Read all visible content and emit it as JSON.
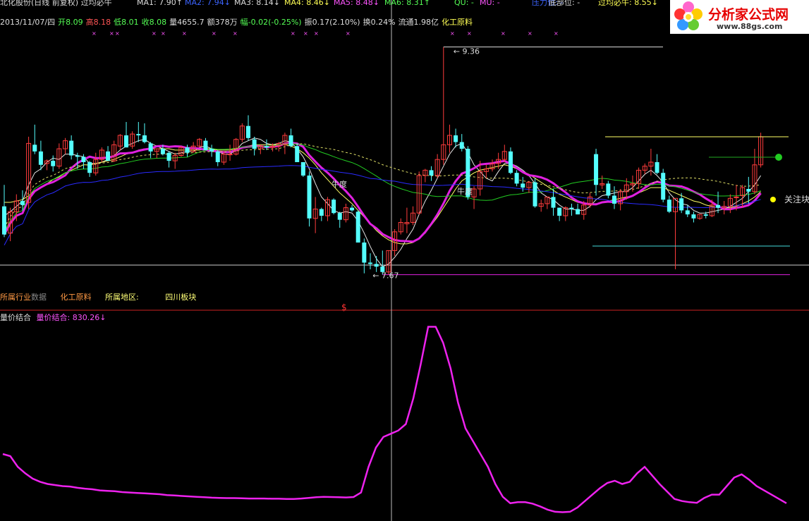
{
  "header_top": [
    {
      "text": "北化股份(日线 前复权) 过均必牛",
      "color": "#dddddd"
    },
    {
      "text": "MA1: 7.90↑",
      "color": "#dddddd"
    },
    {
      "text": "MA2: 7.94↓",
      "color": "#3c64ff"
    },
    {
      "text": "MA3: 8.14↓",
      "color": "#dddddd"
    },
    {
      "text": "MA4: 8.46↓",
      "color": "#ffff55"
    },
    {
      "text": "MA5: 8.48↓",
      "color": "#ff55ff"
    },
    {
      "text": "MA6: 8.31↑",
      "color": "#55ff55"
    },
    {
      "text": "QU: -",
      "color": "#55ff55"
    },
    {
      "text": "MU: -",
      "color": "#ff55ff"
    },
    {
      "text": "压力位: -",
      "color": "#3c64ff"
    },
    {
      "text": "底部位: -",
      "color": "#dddddd"
    },
    {
      "text": "过均必牛: 8.55↓",
      "color": "#ffff55"
    }
  ],
  "quote_line": [
    {
      "text": "2013/11/07/四",
      "color": "#dddddd"
    },
    {
      "text": "开8.09",
      "color": "#55ff55"
    },
    {
      "text": "高8.18",
      "color": "#ff5555"
    },
    {
      "text": "低8.01",
      "color": "#55ff55"
    },
    {
      "text": "收8.08",
      "color": "#55ff55"
    },
    {
      "text": "量4655.7",
      "color": "#dddddd"
    },
    {
      "text": "额378万",
      "color": "#dddddd"
    },
    {
      "text": "幅-0.02(-0.25%)",
      "color": "#55ff55"
    },
    {
      "text": "振0.17(2.10%)",
      "color": "#dddddd"
    },
    {
      "text": "换0.24%",
      "color": "#dddddd"
    },
    {
      "text": "流通1.98亿",
      "color": "#dddddd"
    },
    {
      "text": "化工原料",
      "color": "#ffff55"
    }
  ],
  "sub_info": {
    "industry_label": "所属行业",
    "industry_ghost": "数据",
    "industry_value": "化工原料",
    "region_label": "所属地区:",
    "region_value": "四川板块"
  },
  "lower_header": {
    "name": "量价结合",
    "value_text": "量价结合: 830.26↓"
  },
  "annotations": {
    "high": "9.36",
    "low": "7.67",
    "label_a": "牛度",
    "label_b": "牛度",
    "label_c": "关注块",
    "marker": "$"
  },
  "logo": {
    "title": "分析家公式网",
    "url": "www.88gs.com"
  },
  "colors": {
    "up": "#ff3c3c",
    "down": "#54ffff",
    "ma_white": "#e6e6e6",
    "ma_yellow": "#ffff66",
    "ma_magenta": "#e020e0",
    "ma_green": "#22cc22",
    "ma_blue": "#2a2aff"
  },
  "chart_data": [
    {
      "type": "candlestick",
      "title": "",
      "ylim": [
        7.5,
        9.5
      ],
      "candles": [
        [
          8.17,
          8.33,
          7.94,
          7.96
        ],
        [
          7.97,
          8.16,
          7.91,
          8.13
        ],
        [
          8.13,
          8.26,
          8.06,
          8.21
        ],
        [
          8.21,
          8.29,
          8.14,
          8.18
        ],
        [
          8.2,
          8.69,
          8.15,
          8.64
        ],
        [
          8.63,
          8.78,
          8.56,
          8.58
        ],
        [
          8.58,
          8.66,
          8.44,
          8.48
        ],
        [
          8.49,
          8.52,
          8.44,
          8.51
        ],
        [
          8.51,
          8.55,
          8.43,
          8.47
        ],
        [
          8.47,
          8.64,
          8.45,
          8.6
        ],
        [
          8.6,
          8.68,
          8.56,
          8.66
        ],
        [
          8.66,
          8.7,
          8.52,
          8.55
        ],
        [
          8.55,
          8.57,
          8.45,
          8.54
        ],
        [
          8.54,
          8.56,
          8.45,
          8.5
        ],
        [
          8.5,
          8.51,
          8.39,
          8.42
        ],
        [
          8.42,
          8.57,
          8.4,
          8.52
        ],
        [
          8.52,
          8.61,
          8.5,
          8.59
        ],
        [
          8.58,
          8.62,
          8.51,
          8.51
        ],
        [
          8.51,
          8.66,
          8.5,
          8.63
        ],
        [
          8.62,
          8.71,
          8.59,
          8.7
        ],
        [
          8.7,
          8.8,
          8.61,
          8.61
        ],
        [
          8.62,
          8.73,
          8.6,
          8.71
        ],
        [
          8.71,
          8.8,
          8.65,
          8.7
        ],
        [
          8.7,
          8.79,
          8.64,
          8.65
        ],
        [
          8.64,
          8.65,
          8.53,
          8.58
        ],
        [
          8.58,
          8.6,
          8.53,
          8.6
        ],
        [
          8.6,
          8.63,
          8.55,
          8.56
        ],
        [
          8.57,
          8.58,
          8.46,
          8.51
        ],
        [
          8.51,
          8.57,
          8.45,
          8.55
        ],
        [
          8.55,
          8.62,
          8.54,
          8.61
        ],
        [
          8.61,
          8.63,
          8.54,
          8.57
        ],
        [
          8.58,
          8.65,
          8.57,
          8.62
        ],
        [
          8.62,
          8.68,
          8.61,
          8.67
        ],
        [
          8.66,
          8.68,
          8.59,
          8.59
        ],
        [
          8.6,
          8.63,
          8.54,
          8.58
        ],
        [
          8.58,
          8.59,
          8.47,
          8.5
        ],
        [
          8.5,
          8.58,
          8.48,
          8.56
        ],
        [
          8.56,
          8.63,
          8.51,
          8.56
        ],
        [
          8.56,
          8.68,
          8.55,
          8.67
        ],
        [
          8.67,
          8.79,
          8.65,
          8.77
        ],
        [
          8.77,
          8.85,
          8.66,
          8.68
        ],
        [
          8.67,
          8.69,
          8.55,
          8.6
        ],
        [
          8.6,
          8.63,
          8.56,
          8.62
        ],
        [
          8.62,
          8.67,
          8.59,
          8.61
        ],
        [
          8.61,
          8.64,
          8.58,
          8.62
        ],
        [
          8.62,
          8.65,
          8.58,
          8.64
        ],
        [
          8.63,
          8.72,
          8.56,
          8.7
        ],
        [
          8.7,
          8.75,
          8.61,
          8.62
        ],
        [
          8.62,
          8.64,
          8.5,
          8.5
        ],
        [
          8.5,
          8.39,
          8.4,
          8.4
        ],
        [
          8.4,
          8.43,
          8.02,
          8.08
        ],
        [
          8.08,
          8.24,
          7.97,
          8.15
        ],
        [
          8.15,
          8.16,
          8.06,
          8.1
        ],
        [
          8.1,
          8.24,
          8.06,
          8.22
        ],
        [
          8.22,
          8.23,
          8.11,
          8.12
        ],
        [
          8.12,
          8.13,
          8.01,
          8.07
        ],
        [
          8.07,
          8.19,
          8.05,
          8.16
        ],
        [
          8.16,
          8.18,
          8.13,
          8.14
        ],
        [
          8.13,
          8.14,
          7.92,
          7.9
        ],
        [
          7.9,
          7.93,
          7.67,
          7.75
        ],
        [
          7.75,
          7.82,
          7.7,
          7.74
        ],
        [
          7.74,
          7.8,
          7.68,
          7.72
        ],
        [
          7.72,
          7.84,
          7.66,
          7.68
        ],
        [
          7.68,
          7.84,
          7.66,
          7.84
        ],
        [
          7.84,
          8.0,
          7.8,
          7.98
        ],
        [
          7.98,
          8.08,
          7.96,
          8.05
        ],
        [
          8.04,
          8.16,
          7.97,
          8.05
        ],
        [
          8.05,
          8.17,
          8.03,
          8.12
        ],
        [
          8.12,
          8.43,
          8.11,
          8.4
        ],
        [
          8.4,
          8.45,
          8.35,
          8.44
        ],
        [
          8.44,
          8.47,
          8.36,
          8.4
        ],
        [
          8.4,
          8.56,
          8.38,
          8.52
        ],
        [
          8.52,
          9.36,
          8.48,
          8.63
        ],
        [
          8.63,
          8.78,
          8.57,
          8.7
        ],
        [
          8.7,
          8.75,
          8.61,
          8.65
        ],
        [
          8.65,
          8.71,
          8.58,
          8.6
        ],
        [
          8.6,
          8.62,
          8.22,
          8.24
        ],
        [
          8.24,
          8.32,
          8.15,
          8.3
        ],
        [
          8.3,
          8.51,
          8.25,
          8.43
        ],
        [
          8.43,
          8.48,
          8.38,
          8.45
        ],
        [
          8.45,
          8.52,
          8.43,
          8.49
        ],
        [
          8.49,
          8.57,
          8.45,
          8.52
        ],
        [
          8.52,
          8.63,
          8.5,
          8.58
        ],
        [
          8.58,
          8.61,
          8.41,
          8.42
        ],
        [
          8.42,
          8.44,
          8.32,
          8.34
        ],
        [
          8.34,
          8.39,
          8.28,
          8.31
        ],
        [
          8.31,
          8.36,
          8.27,
          8.35
        ],
        [
          8.35,
          8.38,
          8.16,
          8.17
        ],
        [
          8.17,
          8.22,
          8.13,
          8.19
        ],
        [
          8.19,
          8.24,
          8.15,
          8.24
        ],
        [
          8.24,
          8.3,
          8.1,
          8.16
        ],
        [
          8.16,
          8.16,
          8.06,
          8.1
        ],
        [
          8.1,
          8.17,
          8.06,
          8.16
        ],
        [
          8.16,
          8.19,
          8.1,
          8.15
        ],
        [
          8.15,
          8.19,
          8.11,
          8.11
        ],
        [
          8.11,
          8.21,
          8.07,
          8.18
        ],
        [
          8.18,
          8.27,
          8.16,
          8.24
        ],
        [
          8.56,
          8.6,
          8.25,
          8.33
        ],
        [
          8.33,
          8.4,
          8.3,
          8.34
        ],
        [
          8.34,
          8.36,
          8.23,
          8.25
        ],
        [
          8.25,
          8.32,
          8.15,
          8.19
        ],
        [
          8.19,
          8.3,
          8.14,
          8.28
        ],
        [
          8.28,
          8.38,
          8.22,
          8.33
        ],
        [
          8.33,
          8.4,
          8.28,
          8.34
        ],
        [
          8.34,
          8.46,
          8.3,
          8.44
        ],
        [
          8.44,
          8.49,
          8.41,
          8.47
        ],
        [
          8.47,
          8.6,
          8.4,
          8.5
        ],
        [
          8.5,
          8.56,
          8.41,
          8.42
        ],
        [
          8.42,
          8.45,
          8.2,
          8.22
        ],
        [
          8.22,
          8.25,
          8.12,
          8.13
        ],
        [
          8.13,
          8.16,
          7.7,
          8.23
        ],
        [
          8.23,
          8.27,
          8.12,
          8.14
        ],
        [
          8.14,
          8.18,
          8.09,
          8.11
        ],
        [
          8.11,
          8.13,
          8.05,
          8.08
        ],
        [
          8.08,
          8.11,
          8.07,
          8.11
        ],
        [
          8.11,
          8.13,
          8.08,
          8.1
        ],
        [
          8.1,
          8.22,
          8.09,
          8.18
        ],
        [
          8.18,
          8.28,
          8.12,
          8.16
        ],
        [
          8.16,
          8.21,
          8.11,
          8.17
        ],
        [
          8.17,
          8.26,
          8.12,
          8.23
        ],
        [
          8.24,
          8.33,
          8.14,
          8.24
        ],
        [
          8.25,
          8.33,
          8.16,
          8.31
        ],
        [
          8.3,
          8.39,
          8.19,
          8.28
        ],
        [
          8.28,
          8.6,
          8.26,
          8.48
        ],
        [
          8.48,
          8.72,
          8.46,
          8.69
        ]
      ],
      "ma": {
        "white": [
          8.1,
          8.13,
          8.17,
          8.21,
          8.33,
          8.42,
          8.45,
          8.5,
          8.53,
          8.52,
          8.56,
          8.56,
          8.55,
          8.54,
          8.49,
          8.49,
          8.5,
          8.52,
          8.55,
          8.59,
          8.62,
          8.64,
          8.66,
          8.67,
          8.64,
          8.62,
          8.6,
          8.58,
          8.56,
          8.57,
          8.58,
          8.58,
          8.61,
          8.62,
          8.6,
          8.58,
          8.56,
          8.56,
          8.59,
          8.64,
          8.66,
          8.68,
          8.67,
          8.64,
          8.63,
          8.64,
          8.66,
          8.65,
          8.6,
          8.54,
          8.45,
          8.34,
          8.24,
          8.19,
          8.14,
          8.12,
          8.13,
          8.12,
          8.06,
          7.97,
          7.87,
          7.78,
          7.72,
          7.74,
          7.79,
          7.85,
          7.93,
          8.0,
          8.11,
          8.21,
          8.29,
          8.38,
          8.47,
          8.56,
          8.62,
          8.64,
          8.57,
          8.48,
          8.43,
          8.38,
          8.36,
          8.43,
          8.49,
          8.49,
          8.47,
          8.44,
          8.4,
          8.34,
          8.27,
          8.24,
          8.22,
          8.18,
          8.15,
          8.15,
          8.14,
          8.14,
          8.17,
          8.22,
          8.25,
          8.26,
          8.27,
          8.28,
          8.28,
          8.31,
          8.36,
          8.41,
          8.44,
          8.4,
          8.35,
          8.27,
          8.22,
          8.19,
          8.18,
          8.14,
          8.12,
          8.12,
          8.13,
          8.14,
          8.15,
          8.17,
          8.2,
          8.23,
          8.28,
          8.33,
          8.4
        ],
        "yellow": [
          8.2,
          8.2,
          8.21,
          8.22,
          8.25,
          8.29,
          8.31,
          8.34,
          8.37,
          8.39,
          8.42,
          8.44,
          8.46,
          8.48,
          8.48,
          8.49,
          8.5,
          8.51,
          8.52,
          8.54,
          8.56,
          8.57,
          8.59,
          8.6,
          8.6,
          8.6,
          8.6,
          8.6,
          8.59,
          8.59,
          8.59,
          8.59,
          8.59,
          8.6,
          8.6,
          8.59,
          8.59,
          8.59,
          8.6,
          8.61,
          8.62,
          8.63,
          8.63,
          8.63,
          8.63,
          8.63,
          8.63,
          8.62,
          8.6,
          8.57,
          8.53,
          8.48,
          8.42,
          8.37,
          8.32,
          8.27,
          8.23,
          8.19,
          8.14,
          8.09,
          8.04,
          7.99,
          7.95,
          7.92,
          7.9,
          7.89,
          7.89,
          7.9,
          7.93,
          7.97,
          8.03,
          8.09,
          8.16,
          8.23,
          8.3,
          8.36,
          8.39,
          8.42,
          8.44,
          8.45,
          8.46,
          8.47,
          8.48,
          8.47,
          8.45,
          8.43,
          8.41,
          8.38,
          8.35,
          8.32,
          8.29,
          8.26,
          8.24,
          8.22,
          8.2,
          8.19,
          8.19,
          8.19,
          8.2,
          8.21,
          8.22,
          8.23,
          8.24,
          8.25,
          8.27,
          8.29,
          8.31,
          8.31,
          8.31,
          8.29,
          8.27,
          8.25,
          8.23,
          8.21,
          8.2,
          8.18,
          8.17,
          8.16,
          8.16,
          8.16,
          8.17,
          8.19,
          8.21,
          8.24,
          8.28
        ]
      }
    },
    {
      "type": "line",
      "title": "量价结合",
      "series": [
        {
          "name": "量价结合",
          "values": [
            300,
            290,
            240,
            210,
            185,
            170,
            160,
            155,
            150,
            148,
            142,
            138,
            135,
            130,
            128,
            126,
            122,
            120,
            118,
            116,
            114,
            112,
            108,
            106,
            104,
            102,
            100,
            98,
            96,
            95,
            94,
            94,
            93,
            92,
            92,
            92,
            91,
            91,
            90,
            90,
            92,
            95,
            98,
            100,
            99,
            98,
            97,
            99,
            120,
            240,
            330,
            380,
            395,
            410,
            440,
            560,
            720,
            895,
            895,
            820,
            700,
            540,
            420,
            360,
            300,
            240,
            160,
            100,
            70,
            75,
            75,
            68,
            55,
            40,
            30,
            28,
            30,
            50,
            80,
            110,
            140,
            165,
            175,
            160,
            170,
            210,
            240,
            200,
            160,
            125,
            90,
            80,
            75,
            72,
            95,
            110,
            110,
            150,
            190,
            205,
            180,
            150,
            130,
            110,
            90,
            70
          ]
        }
      ]
    }
  ]
}
